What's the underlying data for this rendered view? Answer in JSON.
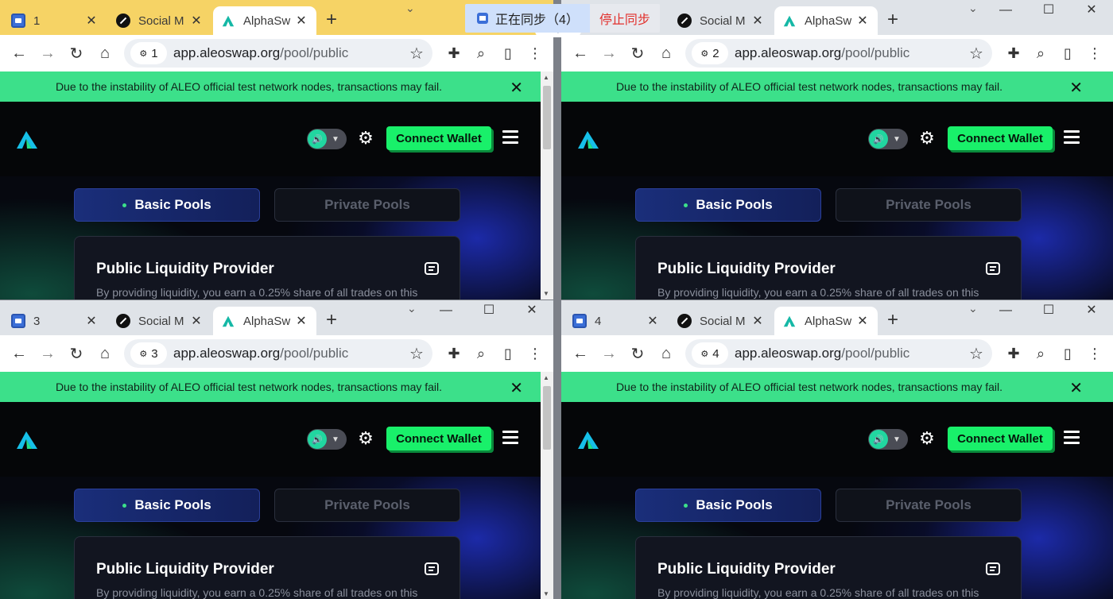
{
  "sync_bar": {
    "syncing_label": "正在同步（4）",
    "stop_label": "停止同步"
  },
  "windows": [
    {
      "profile_number": "1",
      "tabs": [
        "1",
        "Social M",
        "AlphaSw"
      ]
    },
    {
      "profile_number": "2",
      "tabs": [
        "2",
        "Social M",
        "AlphaSw"
      ]
    },
    {
      "profile_number": "3",
      "tabs": [
        "3",
        "Social M",
        "AlphaSw"
      ]
    },
    {
      "profile_number": "4",
      "tabs": [
        "4",
        "Social M",
        "AlphaSw"
      ]
    }
  ],
  "address_bar": {
    "host": "app.aleoswap.org",
    "path": "/pool/public"
  },
  "page": {
    "banner_text": "Due to the instability of ALEO official test network nodes, transactions may fail.",
    "connect_wallet": "Connect Wallet",
    "tabs": {
      "basic": "Basic Pools",
      "private": "Private Pools"
    },
    "card_title": "Public Liquidity Provider",
    "card_desc": "By providing liquidity, you earn a 0.25% share of all trades on this"
  },
  "colors": {
    "banner": "#3ce08a",
    "connect_wallet": "#19f06a",
    "active_tab": "#1a2e7a"
  }
}
